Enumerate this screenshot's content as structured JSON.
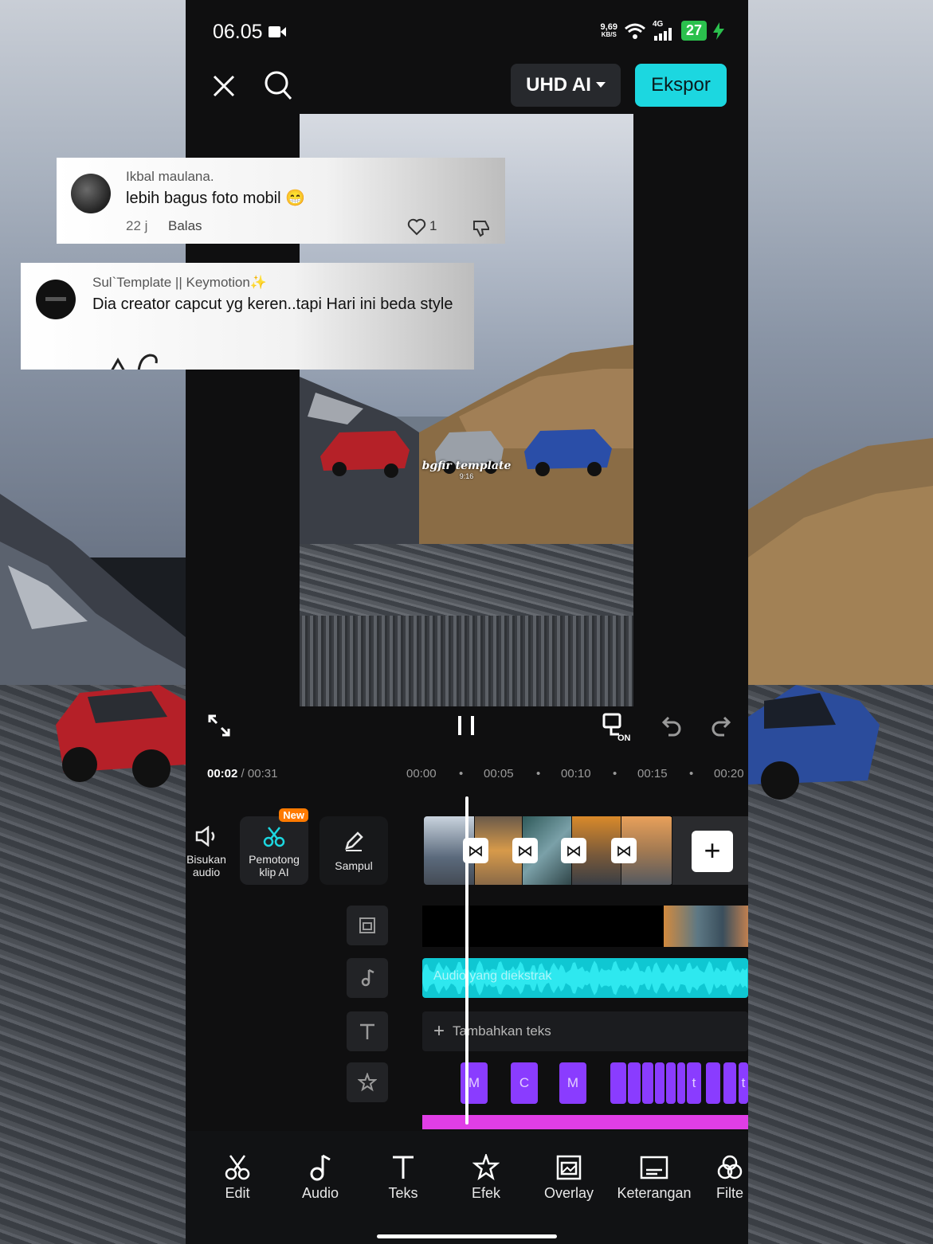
{
  "status_bar": {
    "time": "06.05",
    "net_speed_top": "9,69",
    "net_speed_bottom": "KB/S",
    "network": "4G",
    "battery": "27"
  },
  "header": {
    "quality_label": "UHD AI",
    "export_label": "Ekspor"
  },
  "preview": {
    "overlay_title": "bgfir template",
    "overlay_sub": "9:16"
  },
  "timeline": {
    "current_time": "00:02",
    "separator": " / ",
    "total_time": "00:31",
    "ruler": [
      "00:00",
      "00:05",
      "00:10",
      "00:15",
      "00:20"
    ],
    "ruler_dot": "•"
  },
  "tools": {
    "mute_label": "Bisukan audio",
    "ai_cut_label": "Pemotong klip AI",
    "ai_cut_badge": "New",
    "cover_label": "Sampul"
  },
  "tracks": {
    "audio_label": "Audio yang diekstrak",
    "add_text_label": "Tambahkan teks",
    "fx_labels": [
      "M",
      "C",
      "M",
      "t",
      "t"
    ]
  },
  "bottom_nav": {
    "items": [
      "Edit",
      "Audio",
      "Teks",
      "Efek",
      "Overlay",
      "Keterangan",
      "Filte"
    ]
  },
  "comments": [
    {
      "author": "Ikbal maulana.",
      "text": "lebih bagus foto mobil 😁",
      "age": "22 j",
      "reply_label": "Balas",
      "likes": "1"
    },
    {
      "author": "Sul`Template || Keymotion✨",
      "text": "Dia creator capcut yg keren..tapi Hari ini beda style"
    }
  ],
  "colors": {
    "accent": "#1cd7e0",
    "audio": "#0fc7d2",
    "effect": "#8a3cff",
    "pink_track": "#e03ee6",
    "badge": "#ff7a00"
  }
}
